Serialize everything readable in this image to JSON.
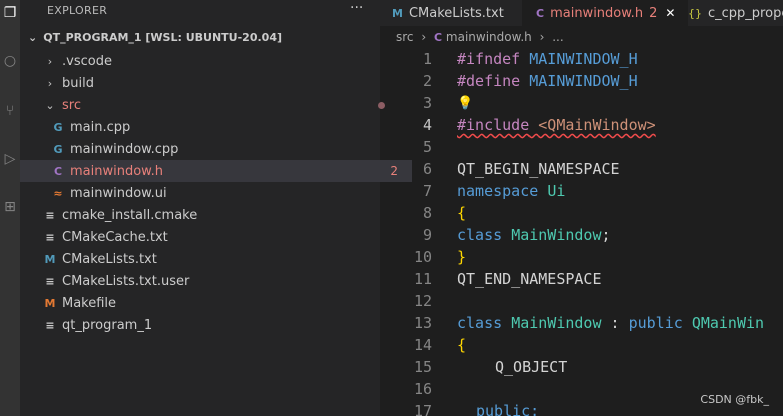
{
  "sidebar": {
    "title": "EXPLORER",
    "more": "···",
    "section": "QT_PROGRAM_1 [WSL: UBUNTU-20.04]",
    "items": [
      {
        "label": ".vscode",
        "badge": ""
      },
      {
        "label": "build",
        "badge": ""
      },
      {
        "label": "src",
        "badge": ""
      },
      {
        "label": "main.cpp",
        "badge": ""
      },
      {
        "label": "mainwindow.cpp",
        "badge": ""
      },
      {
        "label": "mainwindow.h",
        "badge": "2"
      },
      {
        "label": "mainwindow.ui",
        "badge": ""
      },
      {
        "label": "cmake_install.cmake",
        "badge": ""
      },
      {
        "label": "CMakeCache.txt",
        "badge": ""
      },
      {
        "label": "CMakeLists.txt",
        "badge": ""
      },
      {
        "label": "CMakeLists.txt.user",
        "badge": ""
      },
      {
        "label": "Makefile",
        "badge": ""
      },
      {
        "label": "qt_program_1",
        "badge": ""
      }
    ]
  },
  "tabs": [
    {
      "label": "CMakeLists.txt"
    },
    {
      "label": "mainwindow.h",
      "badge": "2",
      "close": "✕"
    },
    {
      "label": "c_cpp_prope"
    }
  ],
  "breadcrumb": {
    "folder": "src",
    "file": "mainwindow.h",
    "trail": "›"
  },
  "code": {
    "lines": [
      "1",
      "2",
      "3",
      "4",
      "5",
      "6",
      "7",
      "8",
      "9",
      "10",
      "11",
      "12",
      "13",
      "14",
      "15",
      "16",
      "17"
    ],
    "l1a": "#ifndef",
    "l1b": "MAINWINDOW_H",
    "l2a": "#define",
    "l2b": "MAINWINDOW_H",
    "l4a": "#include",
    "l4b": "<QMainWindow>",
    "l6": "QT_BEGIN_NAMESPACE",
    "l7a": "namespace",
    "l7b": "Ui",
    "l8": "{",
    "l9a": "class",
    "l9b": "MainWindow",
    "l9c": ";",
    "l10": "}",
    "l11": "QT_END_NAMESPACE",
    "l13a": "class",
    "l13b": "MainWindow",
    "l13c": " : ",
    "l13d": "public",
    "l13e": "QMainWin",
    "l14": "{",
    "l15": "Q_OBJECT",
    "l17": "public:"
  },
  "watermark": "CSDN @fbk_",
  "colors": {
    "accent_modified": "#e8807a",
    "badge_red": "#f48771"
  }
}
